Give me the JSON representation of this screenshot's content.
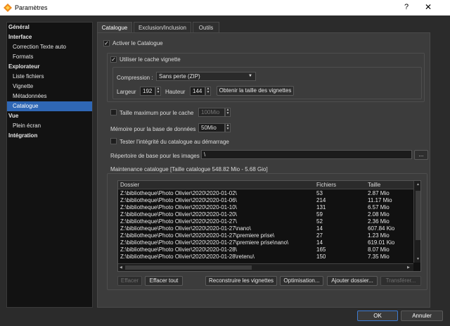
{
  "window": {
    "title": "Paramètres",
    "help": "?",
    "close": "✕"
  },
  "sidebar": [
    {
      "label": "Général",
      "type": "cat"
    },
    {
      "label": "Interface",
      "type": "cat"
    },
    {
      "label": "Correction Texte auto",
      "type": "sub"
    },
    {
      "label": "Formats",
      "type": "sub"
    },
    {
      "label": "Explorateur",
      "type": "cat"
    },
    {
      "label": "Liste fichiers",
      "type": "sub"
    },
    {
      "label": "Vignette",
      "type": "sub"
    },
    {
      "label": "Métadonnées",
      "type": "sub"
    },
    {
      "label": "Catalogue",
      "type": "sub",
      "selected": true
    },
    {
      "label": "Vue",
      "type": "cat"
    },
    {
      "label": "Plein écran",
      "type": "sub"
    },
    {
      "label": "Intégration",
      "type": "cat"
    }
  ],
  "tabs": [
    "Catalogue",
    "Exclusion/Inclusion",
    "Outils"
  ],
  "catalogue": {
    "activate_label": "Activer le Catalogue",
    "thumb_cache_label": "Utiliser le cache vignette",
    "compression_label": "Compression :",
    "compression_value": "Sans perte (ZIP)",
    "width_label": "Largeur",
    "width_value": "192",
    "height_label": "Hauteur",
    "height_value": "144",
    "get_size_button": "Obtenir la taille des vignettes",
    "max_cache_label": "Taille maximum pour le cache",
    "max_cache_value": "100Mio",
    "db_memory_label": "Mémoire pour la base de données",
    "db_memory_value": "50Mio",
    "integrity_label": "Tester l'intégrité du catalogue au démarrage",
    "base_dir_label": "Répertoire de base pour les images",
    "base_dir_value": "\\",
    "browse_button": "...",
    "maintenance_label": "Maintenance catalogue [Taille catalogue 548.82 Mio - 5.68 Gio]"
  },
  "table": {
    "headers": [
      "Dossier",
      "Fichiers",
      "Taille"
    ],
    "rows": [
      [
        "Z:\\bibliotheque\\Photo Olivier\\2020\\2020-01-02\\",
        "53",
        "2.87 Mio"
      ],
      [
        "Z:\\bibliotheque\\Photo Olivier\\2020\\2020-01-06\\",
        "214",
        "11.17 Mio"
      ],
      [
        "Z:\\bibliotheque\\Photo Olivier\\2020\\2020-01-10\\",
        "131",
        "6.57 Mio"
      ],
      [
        "Z:\\bibliotheque\\Photo Olivier\\2020\\2020-01-20\\",
        "59",
        "2.08 Mio"
      ],
      [
        "Z:\\bibliotheque\\Photo Olivier\\2020\\2020-01-27\\",
        "52",
        "2.36 Mio"
      ],
      [
        "Z:\\bibliotheque\\Photo Olivier\\2020\\2020-01-27\\nano\\",
        "14",
        "607.84 Kio"
      ],
      [
        "Z:\\bibliotheque\\Photo Olivier\\2020\\2020-01-27\\premiere prise\\",
        "27",
        "1.23 Mio"
      ],
      [
        "Z:\\bibliotheque\\Photo Olivier\\2020\\2020-01-27\\premiere prise\\nano\\",
        "14",
        "619.01 Kio"
      ],
      [
        "Z:\\bibliotheque\\Photo Olivier\\2020\\2020-01-28\\",
        "165",
        "8.07 Mio"
      ],
      [
        "Z:\\bibliotheque\\Photo Olivier\\2020\\2020-01-28\\retenu\\",
        "150",
        "7.35 Mio"
      ]
    ]
  },
  "actions": {
    "clear": "Effacer",
    "clear_all": "Effacer tout",
    "rebuild": "Reconstruire les vignettes",
    "optimize": "Optimisation...",
    "add_folder": "Ajouter dossier...",
    "transfer": "Transférer..."
  },
  "footer": {
    "ok": "OK",
    "cancel": "Annuler"
  },
  "colors": {
    "accent": "#2f67b5",
    "panel": "#3c3c3c",
    "background": "#2b2b2b"
  }
}
